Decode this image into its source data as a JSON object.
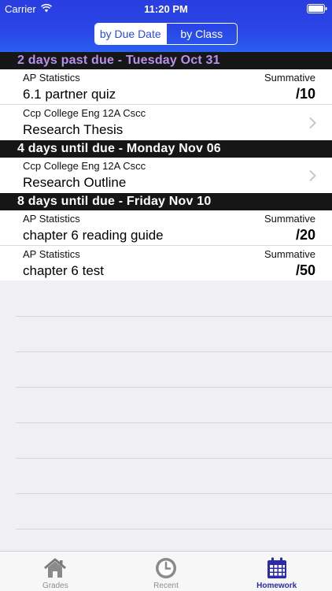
{
  "status_bar": {
    "carrier": "Carrier",
    "time": "11:20 PM"
  },
  "segmented": {
    "by_due_date": "by Due Date",
    "by_class": "by Class"
  },
  "colors": {
    "header": "#2a45e6",
    "past_due": "#b690ee",
    "active_tab": "#2b2ba8"
  },
  "sections": [
    {
      "title": "2 days past due - Tuesday Oct 31",
      "items": [
        {
          "class": "AP Statistics",
          "category": "Summative",
          "title": "6.1 partner quiz",
          "score": "/10"
        },
        {
          "class": "Ccp College Eng 12A Cscc",
          "title": "Research Thesis"
        }
      ]
    },
    {
      "title": "4 days until due - Monday Nov 06",
      "items": [
        {
          "class": "Ccp College Eng 12A Cscc",
          "title": "Research Outline"
        }
      ]
    },
    {
      "title": "8 days until due - Friday Nov 10",
      "items": [
        {
          "class": "AP Statistics",
          "category": "Summative",
          "title": "chapter 6 reading guide",
          "score": "/20"
        },
        {
          "class": "AP Statistics",
          "category": "Summative",
          "title": "chapter 6 test",
          "score": "/50"
        }
      ]
    }
  ],
  "tabs": [
    {
      "label": "Grades",
      "icon": "house-icon"
    },
    {
      "label": "Recent",
      "icon": "clock-icon"
    },
    {
      "label": "Homework",
      "icon": "calendar-icon"
    }
  ]
}
